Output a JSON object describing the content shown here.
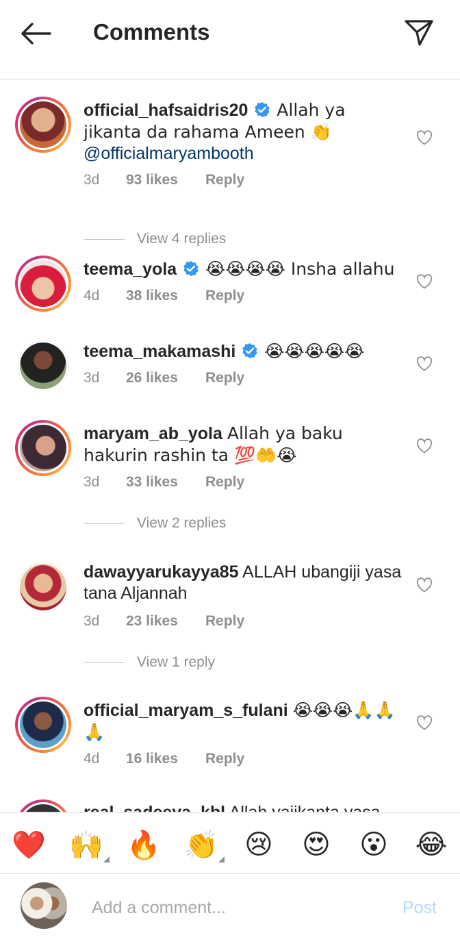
{
  "header": {
    "title": "Comments"
  },
  "comments": [
    {
      "username": "official_hafsaidris20",
      "verified": true,
      "text": "Allah ya jikanta da rahama Ameen 👏",
      "mention": "@officialmaryambooth",
      "time": "3d",
      "likes": "93 likes",
      "reply": "Reply",
      "view_replies": "View 4 replies"
    },
    {
      "username": "teema_yola",
      "verified": true,
      "text": "😭😭😭😭 Insha allahu",
      "time": "4d",
      "likes": "38 likes",
      "reply": "Reply"
    },
    {
      "username": "teema_makamashi",
      "verified": true,
      "text": "😭😭😭😭😭",
      "time": "3d",
      "likes": "26 likes",
      "reply": "Reply"
    },
    {
      "username": "maryam_ab_yola",
      "verified": false,
      "text": "Allah ya baku hakurin rashin ta 💯🤲😭",
      "time": "3d",
      "likes": "33 likes",
      "reply": "Reply",
      "view_replies": "View 2 replies"
    },
    {
      "username": "dawayyarukayya85",
      "verified": false,
      "text": "ALLAH ubangiji yasa tana Aljannah",
      "time": "3d",
      "likes": "23 likes",
      "reply": "Reply",
      "view_replies": "View 1 reply"
    },
    {
      "username": "official_maryam_s_fulani",
      "verified": false,
      "text": "😭😭😭🙏🙏🙏",
      "time": "4d",
      "likes": "16 likes",
      "reply": "Reply"
    },
    {
      "username": "real_sadeeya_kbl",
      "verified": false,
      "text": "Allah yajikanta yasa"
    }
  ],
  "emoji_bar": [
    "❤️",
    "🙌",
    "🔥",
    "👏",
    "😢",
    "😍",
    "😮",
    "😂"
  ],
  "input": {
    "placeholder": "Add a comment...",
    "post_label": "Post"
  },
  "colors": {
    "accent": "#0095f6",
    "post_disabled": "#b3dbff",
    "secondary": "#8e8e8e",
    "mention": "#00376b",
    "verified": "#3897f0"
  },
  "icons": {
    "back": "arrow-left-icon",
    "share": "paper-plane-icon",
    "like": "heart-outline-icon",
    "verified": "verified-badge-icon"
  }
}
